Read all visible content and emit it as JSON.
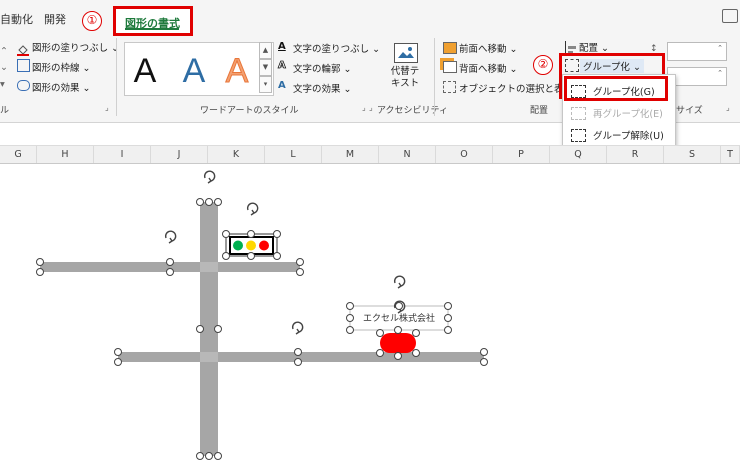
{
  "tabs": {
    "t1": "自動化",
    "t2": "開発",
    "active": "図形の書式"
  },
  "markers": {
    "m1": "①",
    "m2": "②"
  },
  "shape_styles": {
    "fill": "図形の塗りつぶし",
    "outline": "図形の枠線",
    "effects": "図形の効果"
  },
  "wordart": {
    "letter": "A",
    "text_fill": "文字の塗りつぶし",
    "text_outline": "文字の輪郭",
    "text_effects": "文字の効果",
    "group_label": "ワードアートのスタイル"
  },
  "accessibility": {
    "alt_text_1": "代替テ",
    "alt_text_2": "キスト",
    "group_label": "アクセシビリティ"
  },
  "arrange": {
    "bring_forward": "前面へ移動",
    "send_backward": "背面へ移動",
    "selection_pane": "オブジェクトの選択と表示",
    "align": "配置",
    "group": "グループ化",
    "group_label": "配置"
  },
  "size": {
    "group_label": "サイズ"
  },
  "group_menu": {
    "group": "グループ化(G)",
    "regroup": "再グループ化(E)",
    "ungroup": "グループ解除(U)"
  },
  "columns": [
    "G",
    "H",
    "I",
    "J",
    "K",
    "L",
    "M",
    "N",
    "O",
    "P",
    "Q",
    "R",
    "S",
    "T"
  ],
  "canvas": {
    "company_text": "エクセル株式会社"
  },
  "colors": {
    "road": "#a6a6a6",
    "red": "#ff0000",
    "yellow": "#ffd700",
    "green": "#00b050",
    "accent": "#1e7a3c"
  }
}
